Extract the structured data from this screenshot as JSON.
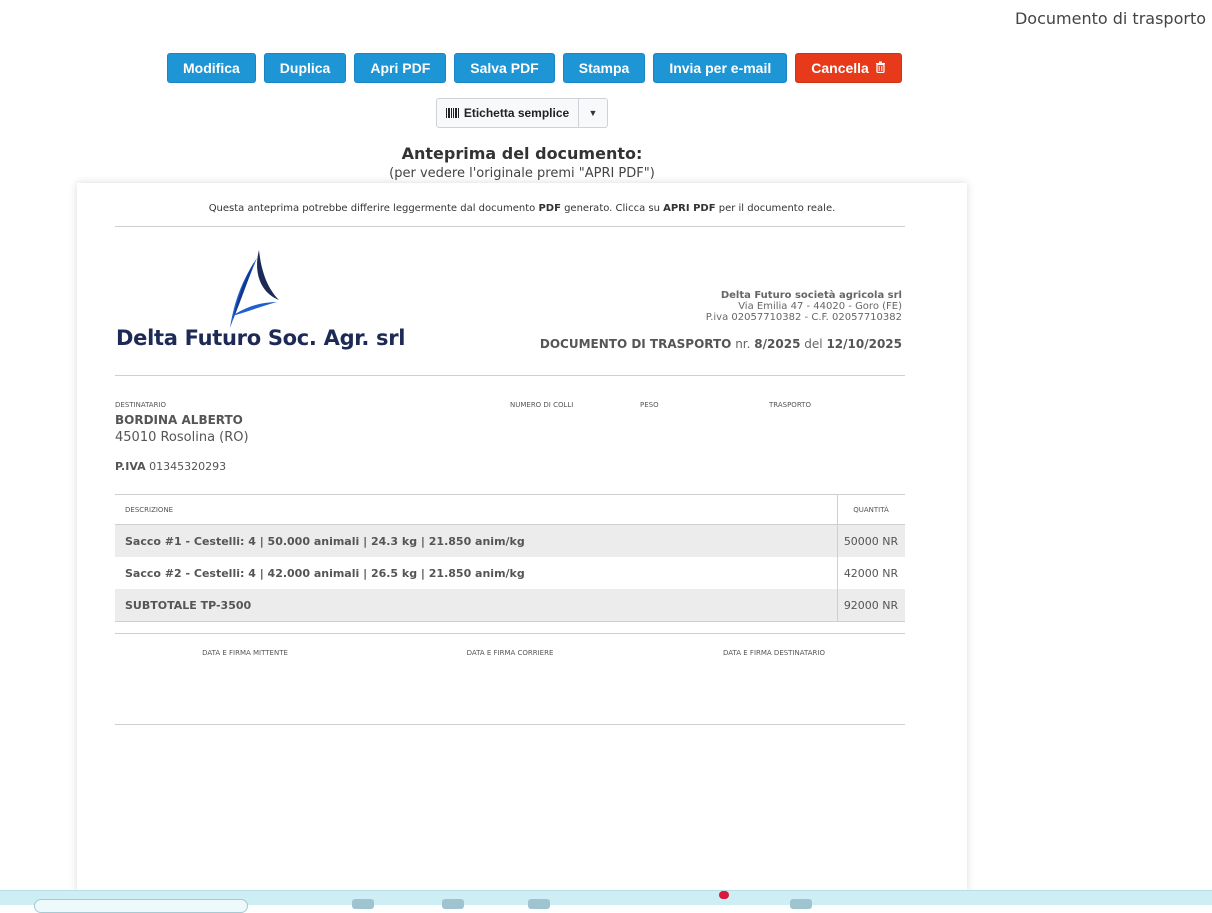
{
  "header": {
    "title": "Documento di trasporto"
  },
  "toolbar": {
    "buttons": [
      "Modifica",
      "Duplica",
      "Apri PDF",
      "Salva PDF",
      "Stampa",
      "Invia per e-mail",
      "Cancella"
    ],
    "delete_icon": "trash-icon"
  },
  "label_select": {
    "value": "Etichetta semplice",
    "icon": "barcode-icon",
    "caret_icon": "caret-down-icon"
  },
  "preview": {
    "title": "Anteprima del documento:",
    "subtitle": "(per vedere l'originale premi \"APRI PDF\")"
  },
  "document": {
    "notice": {
      "part1": "Questa anteprima potrebbe differire leggermente dal documento ",
      "pdf": "PDF",
      "part2": " generato. Clicca su ",
      "apri": "APRI PDF",
      "part3": " per il documento reale."
    },
    "logo_text": "Delta Futuro Soc. Agr. srl",
    "sender": {
      "name": "Delta Futuro società agricola srl",
      "address": "Via Emilia 47 - 44020 - Goro (FE)",
      "tax": "P.iva 02057710382 - C.F. 02057710382"
    },
    "doc_type": "DOCUMENTO DI TRASPORTO",
    "doc_nr_label": "nr.",
    "doc_nr": "8/2025",
    "doc_date_label": "del",
    "doc_date": "12/10/2025",
    "labels": {
      "destinatario": "DESTINATARIO",
      "colli": "NUMERO DI COLLI",
      "peso": "PESO",
      "trasporto": "TRASPORTO"
    },
    "recipient": {
      "name": "BORDINA ALBERTO",
      "city": "45010 Rosolina (RO)",
      "piva_label": "P.IVA",
      "piva": "01345320293"
    },
    "table": {
      "headers": [
        "DESCRIZIONE",
        "QUANTITÀ"
      ],
      "rows": [
        {
          "desc": "Sacco #1 - Cestelli: 4 | 50.000 animali | 24.3 kg | 21.850 anim/kg",
          "qty": "50000 NR"
        },
        {
          "desc": "Sacco #2 - Cestelli: 4 | 42.000 animali | 26.5 kg | 21.850 anim/kg",
          "qty": "42000 NR"
        },
        {
          "desc": "SUBTOTALE TP-3500",
          "qty": "92000 NR"
        }
      ]
    },
    "signatures": [
      "DATA E FIRMA MITTENTE",
      "DATA E FIRMA CORRIERE",
      "DATA E FIRMA DESTINATARIO"
    ]
  }
}
